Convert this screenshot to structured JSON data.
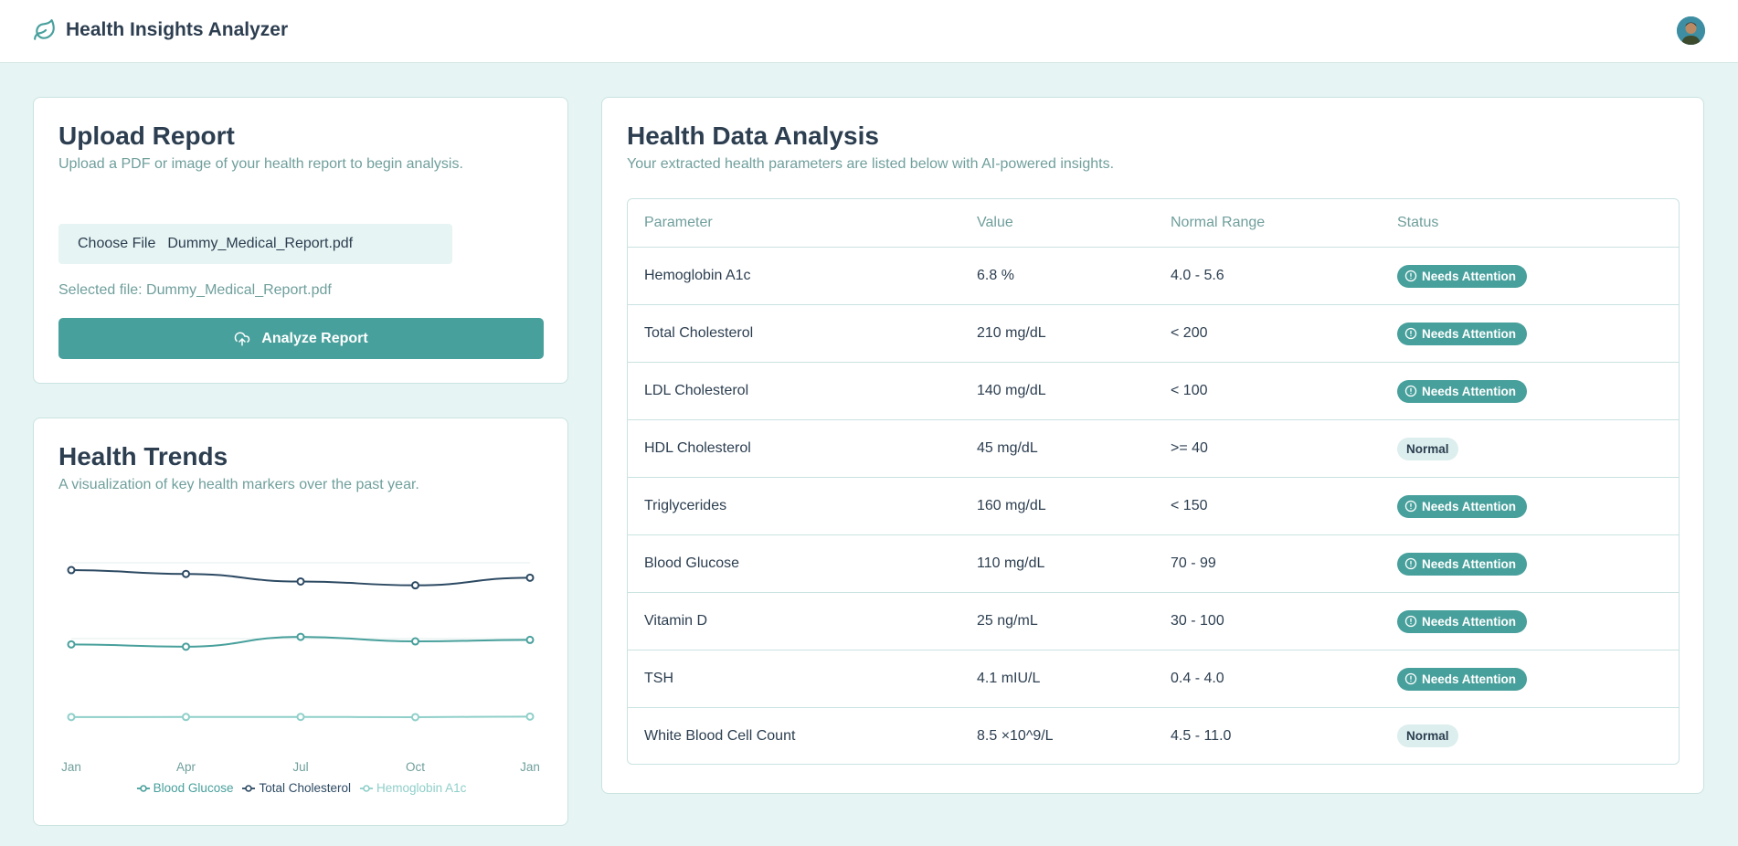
{
  "app": {
    "title": "Health Insights Analyzer",
    "icon": "leaf-icon",
    "accent": "#48a09c"
  },
  "upload": {
    "title": "Upload Report",
    "subtitle": "Upload a PDF or image of your health report to begin analysis.",
    "choose_label": "Choose File",
    "file_name": "Dummy_Medical_Report.pdf",
    "selected_text": "Selected file: Dummy_Medical_Report.pdf",
    "analyze_label": "Analyze Report",
    "analyze_icon": "cloud-upload-icon"
  },
  "trends": {
    "title": "Health Trends",
    "subtitle": "A visualization of key health markers over the past year."
  },
  "chart_data": {
    "type": "line",
    "categories": [
      "Jan",
      "Apr",
      "Jul",
      "Oct",
      "Jan"
    ],
    "ylim": [
      0,
      235
    ],
    "grid": true,
    "legend": "bottom",
    "series": [
      {
        "name": "Blood Glucose",
        "values": [
          102,
          99,
          112,
          106,
          108
        ],
        "color": "#48a09c"
      },
      {
        "name": "Total Cholesterol",
        "values": [
          200,
          195,
          185,
          180,
          190
        ],
        "color": "#2d4a63"
      },
      {
        "name": "Hemoglobin A1c",
        "values": [
          6.2,
          6.3,
          6.4,
          6.1,
          6.8
        ],
        "color": "#8fcfc9"
      }
    ]
  },
  "analysis": {
    "title": "Health Data Analysis",
    "subtitle": "Your extracted health parameters are listed below with AI-powered insights.",
    "headers": [
      "Parameter",
      "Value",
      "Normal Range",
      "Status"
    ],
    "rows": [
      {
        "parameter": "Hemoglobin A1c",
        "value": "6.8 %",
        "range": "4.0 - 5.6",
        "status": "Needs Attention",
        "flag": "warn"
      },
      {
        "parameter": "Total Cholesterol",
        "value": "210 mg/dL",
        "range": "< 200",
        "status": "Needs Attention",
        "flag": "warn"
      },
      {
        "parameter": "LDL Cholesterol",
        "value": "140 mg/dL",
        "range": "< 100",
        "status": "Needs Attention",
        "flag": "warn"
      },
      {
        "parameter": "HDL Cholesterol",
        "value": "45 mg/dL",
        "range": ">= 40",
        "status": "Normal",
        "flag": "ok"
      },
      {
        "parameter": "Triglycerides",
        "value": "160 mg/dL",
        "range": "< 150",
        "status": "Needs Attention",
        "flag": "warn"
      },
      {
        "parameter": "Blood Glucose",
        "value": "110 mg/dL",
        "range": "70 - 99",
        "status": "Needs Attention",
        "flag": "warn"
      },
      {
        "parameter": "Vitamin D",
        "value": "25 ng/mL",
        "range": "30 - 100",
        "status": "Needs Attention",
        "flag": "warn"
      },
      {
        "parameter": "TSH",
        "value": "4.1 mIU/L",
        "range": "0.4 - 4.0",
        "status": "Needs Attention",
        "flag": "warn"
      },
      {
        "parameter": "White Blood Cell Count",
        "value": "8.5 ×10^9/L",
        "range": "4.5 - 11.0",
        "status": "Normal",
        "flag": "ok"
      }
    ]
  }
}
